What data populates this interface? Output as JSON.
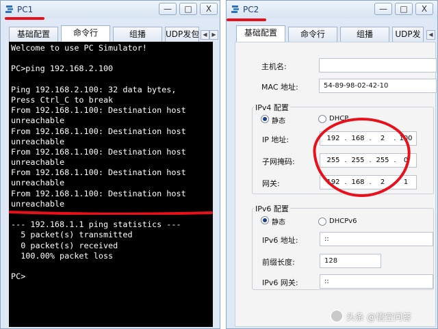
{
  "pc1": {
    "title": "PC1",
    "tabs": [
      "基础配置",
      "命令行",
      "组播",
      "UDP发包"
    ],
    "terminal_lines": [
      "Welcome to use PC Simulator!",
      "",
      "PC>ping 192.168.2.100",
      "",
      "Ping 192.168.2.100: 32 data bytes,",
      "Press Ctrl_C to break",
      "From 192.168.1.100: Destination host",
      "unreachable",
      "From 192.168.1.100: Destination host",
      "unreachable",
      "From 192.168.1.100: Destination host",
      "unreachable",
      "From 192.168.1.100: Destination host",
      "unreachable",
      "From 192.168.1.100: Destination host",
      "unreachable",
      "",
      "--- 192.168.1.1 ping statistics ---",
      "  5 packet(s) transmitted",
      "  0 packet(s) received",
      "  100.00% packet loss",
      "",
      "PC>"
    ]
  },
  "pc2": {
    "title": "PC2",
    "tabs": [
      "基础配置",
      "命令行",
      "组播",
      "UDP发"
    ],
    "hostname": {
      "label": "主机名:",
      "value": ""
    },
    "mac": {
      "label": "MAC 地址:",
      "value": "54-89-98-02-42-10"
    },
    "ipv4": {
      "group_label": "IPv4 配置",
      "static_label": "静态",
      "dhcp_label": "DHCP",
      "ip_label": "IP 地址:",
      "ip": [
        "192",
        "168",
        "2",
        "100"
      ],
      "mask_label": "子网掩码:",
      "mask": [
        "255",
        "255",
        "255",
        "0"
      ],
      "gateway_label": "网关:",
      "gateway": [
        "192",
        "168",
        "2",
        "1"
      ]
    },
    "ipv6": {
      "group_label": "IPv6 配置",
      "static_label": "静态",
      "dhcp_label": "DHCPv6",
      "ip_label": "IPv6 地址:",
      "ip_value": "::",
      "prefix_label": "前缀长度:",
      "prefix_value": "128",
      "gateway_label": "IPv6 网关:",
      "gateway_value": "::"
    }
  },
  "window_buttons": {
    "minimize": "—",
    "maximize": "□",
    "close": "X"
  },
  "scroll_left": "◀",
  "scroll_right": "▶",
  "watermark": "头条 @悟空问答",
  "colors": {
    "annotation_red": "#e8101a",
    "terminal_bg": "#000000",
    "title_text": "#1d3f7a"
  }
}
